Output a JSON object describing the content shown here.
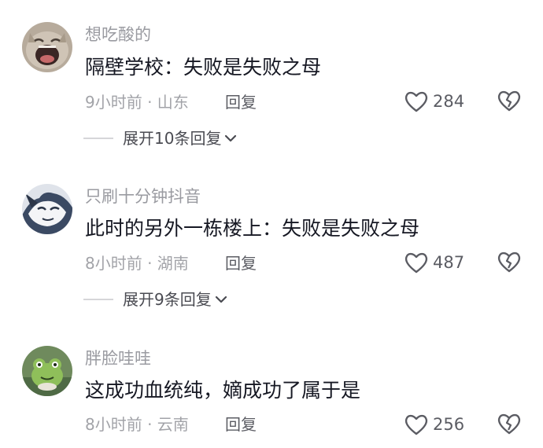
{
  "comments": [
    {
      "username": "想吃酸的",
      "text": "隔壁学校：失败是失败之母",
      "time_location": "9小时前 · 山东",
      "reply_label": "回复",
      "likes": "284",
      "expand_label": "展开10条回复",
      "avatar_icon": "crying-cat-avatar"
    },
    {
      "username": "只刷十分钟抖音",
      "text": "此时的另外一栋楼上：失败是失败之母",
      "time_location": "8小时前 · 湖南",
      "reply_label": "回复",
      "likes": "487",
      "expand_label": "展开9条回复",
      "avatar_icon": "cartoon-face-avatar"
    },
    {
      "username": "胖脸哇哇",
      "text": "这成功血统纯，嫡成功了属于是",
      "time_location": "8小时前 · 云南",
      "reply_label": "回复",
      "likes": "256",
      "avatar_icon": "frog-avatar"
    }
  ],
  "colors": {
    "username": "#9a9ba1",
    "text": "#161823",
    "meta": "#a2a3a8",
    "action": "#5b5c63"
  },
  "icons": [
    "heart-outline-icon",
    "broken-heart-icon",
    "chevron-down-icon"
  ]
}
